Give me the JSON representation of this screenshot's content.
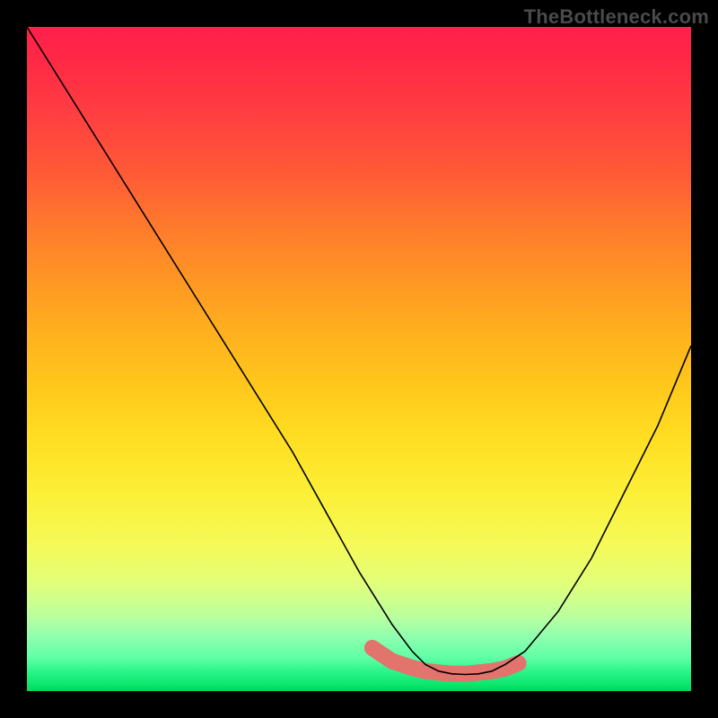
{
  "watermark": "TheBottleneck.com",
  "chart_data": {
    "type": "line",
    "title": "",
    "xlabel": "",
    "ylabel": "",
    "xlim": [
      0,
      100
    ],
    "ylim": [
      0,
      100
    ],
    "grid": false,
    "background_gradient": {
      "orientation": "vertical",
      "stops": [
        {
          "pos": 0.0,
          "color": "#ff1f4b"
        },
        {
          "pos": 0.5,
          "color": "#ffc81c"
        },
        {
          "pos": 0.8,
          "color": "#f5fa58"
        },
        {
          "pos": 1.0,
          "color": "#00d955"
        }
      ]
    },
    "series": [
      {
        "name": "bottleneck-curve",
        "x": [
          0,
          5,
          10,
          15,
          20,
          25,
          30,
          35,
          40,
          45,
          50,
          55,
          58,
          60,
          62,
          64,
          66,
          68,
          70,
          72,
          75,
          80,
          85,
          90,
          95,
          100
        ],
        "y": [
          100,
          92,
          84,
          76,
          68,
          60,
          52,
          44,
          36,
          27,
          18,
          10,
          6,
          4,
          3,
          2.6,
          2.5,
          2.6,
          3,
          4,
          6,
          12,
          20,
          30,
          40,
          52
        ]
      }
    ],
    "annotations": [
      {
        "name": "highlight-band",
        "color": "#e2736d",
        "x": [
          52,
          55,
          58,
          60,
          62,
          64,
          66,
          68,
          70,
          72,
          74
        ],
        "y": [
          6.5,
          4.5,
          3.5,
          3.0,
          2.8,
          2.6,
          2.6,
          2.8,
          3.0,
          3.4,
          4.2
        ]
      }
    ]
  },
  "colors": {
    "curve": "#000000",
    "highlight": "#e2736d",
    "frame": "#000000"
  }
}
